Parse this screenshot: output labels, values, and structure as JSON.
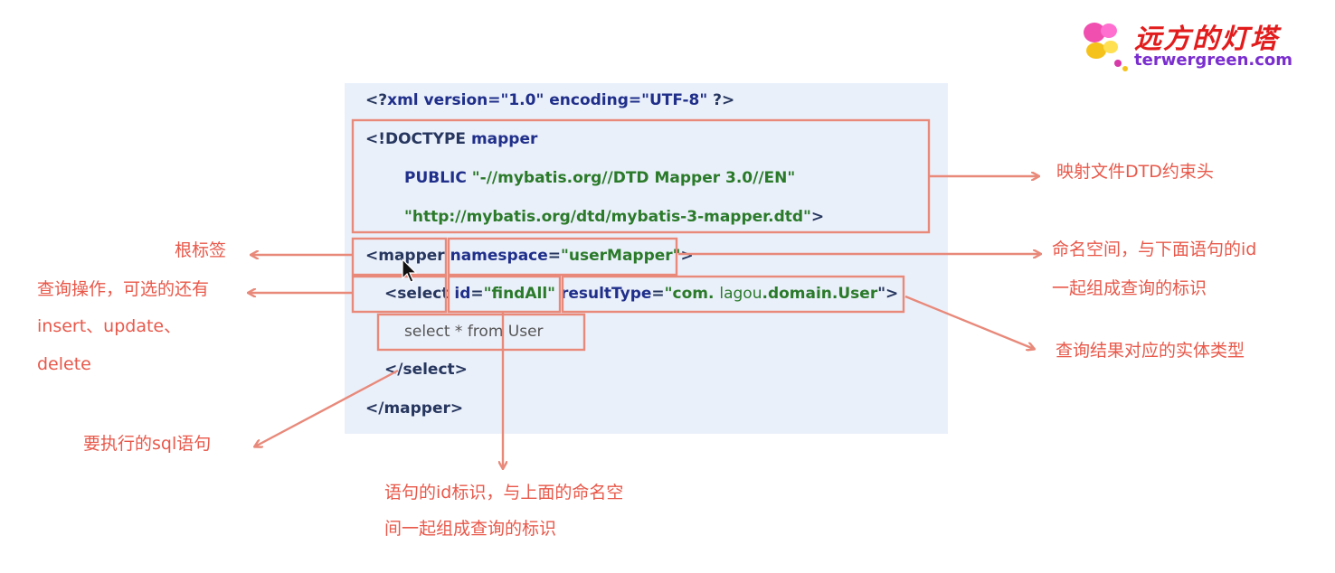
{
  "logo": {
    "title": "远方的灯塔",
    "url": "terwergreen.com"
  },
  "code": {
    "line1": {
      "open": "<?",
      "decl": "xml version=\"1.0\" encoding=\"UTF-8\"",
      "close": "?>"
    },
    "line2": {
      "doctype": "<!DOCTYPE",
      "name": "mapper"
    },
    "line3": {
      "keyword": "PUBLIC",
      "value": "\"-//mybatis.org//DTD Mapper 3.0//EN\""
    },
    "line4": {
      "value": "\"http://mybatis.org/dtd/mybatis-3-mapper.dtd\"",
      "close": ">"
    },
    "line5": {
      "tag": "<mapper",
      "attr": "namespace",
      "eq": "=",
      "value": "\"userMapper\"",
      "close": ">"
    },
    "line6": {
      "tag": "<select",
      "attr1": "id",
      "eq1": "=",
      "value1": "\"findAll\"",
      "attr2": "resultType",
      "eq2": "=",
      "value2a": "\"com.",
      "value2b": "lagou",
      "value2c": ".domain.User",
      "close": "\">"
    },
    "line7": {
      "sql": "select * from User"
    },
    "line8": {
      "tag": "</select>"
    },
    "line9": {
      "tag": "</mapper>"
    }
  },
  "annotations": {
    "dtd": "映射文件DTD约束头",
    "namespace_line1": "命名空间，与下面语句的id",
    "namespace_line2": "一起组成查询的标识",
    "result_type": "查询结果对应的实体类型",
    "root_tag": "根标签",
    "select_op_line1": "查询操作，可选的还有",
    "select_op_line2": "insert、update、",
    "select_op_line3": "delete",
    "sql_stmt": "要执行的sql语句",
    "id_line1": "语句的id标识，与上面的命名空",
    "id_line2": "间一起组成查询的标识"
  },
  "colors": {
    "annotation": "#e8584a",
    "box": "#e8897a",
    "panel": "#eaf0fa",
    "keyword": "#1f2f8a",
    "string": "#2a7a2a",
    "logo_title": "#e21c1c",
    "logo_url": "#7b2ecf"
  },
  "icons": {
    "logo_mark": "butterfly-icon",
    "cursor": "mouse-pointer-icon"
  }
}
